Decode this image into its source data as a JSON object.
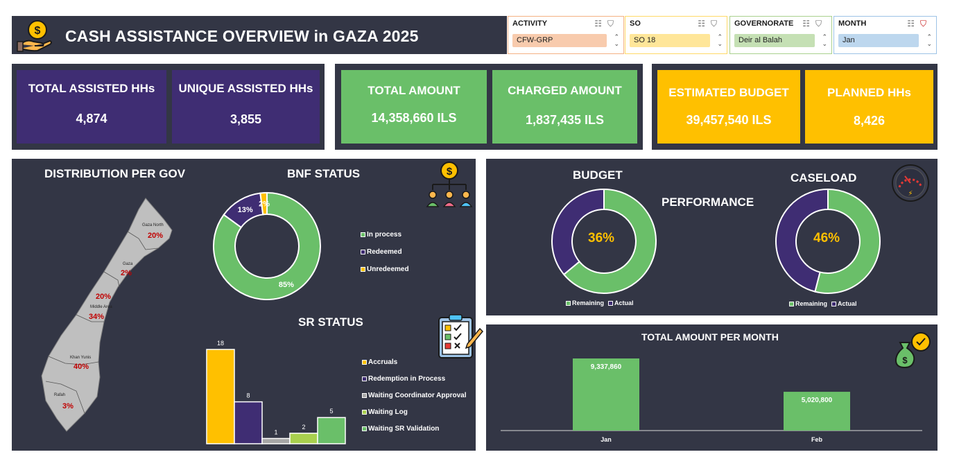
{
  "header": {
    "title": "CASH ASSISTANCE OVERVIEW in GAZA 2025"
  },
  "slicers": [
    {
      "label": "ACTIVITY",
      "value": "CFW-GRP",
      "color": "#f8cbad",
      "border": "#f4b183"
    },
    {
      "label": "SO",
      "value": "SO 18",
      "color": "#ffe699",
      "border": "#ffd966"
    },
    {
      "label": "GOVERNORATE",
      "value": "Deir al Balah",
      "color": "#c5e0b4",
      "border": "#a9d18e"
    },
    {
      "label": "MONTH",
      "value": "Jan",
      "color": "#bdd7ee",
      "border": "#9dc3e6"
    }
  ],
  "kpis": {
    "total_assisted_label": "TOTAL ASSISTED HHs",
    "total_assisted_value": "4,874",
    "unique_assisted_label": "UNIQUE ASSISTED HHs",
    "unique_assisted_value": "3,855",
    "total_amount_label": "TOTAL AMOUNT",
    "total_amount_value": "14,358,660 ILS",
    "charged_amount_label": "CHARGED AMOUNT",
    "charged_amount_value": "1,837,435 ILS",
    "estimated_budget_label": "ESTIMATED BUDGET",
    "estimated_budget_value": "39,457,540 ILS",
    "planned_hhs_label": "PLANNED HHs",
    "planned_hhs_value": "8,426"
  },
  "distribution": {
    "title": "DISTRIBUTION PER GOV",
    "regions": [
      {
        "name": "Gaza North",
        "pct": "20%"
      },
      {
        "name": "Gaza",
        "pct": "2%"
      },
      {
        "name": "Middle Area",
        "pct": "34%",
        "extra_pct": "20%"
      },
      {
        "name": "Khan Yunis",
        "pct": "40%"
      },
      {
        "name": "Rafah",
        "pct": "3%"
      }
    ]
  },
  "performance": {
    "title": "PERFORMANCE",
    "budget_title": "BUDGET",
    "caseload_title": "CASELOAD"
  },
  "colors": {
    "green": "#6abf69",
    "purple": "#3f2d73",
    "yellow": "#ffc000",
    "navy": "#333645",
    "lime": "#a9d04e",
    "gray": "#a6a6a6",
    "pct_text": "#ffc000",
    "map_red": "#c00000"
  },
  "chart_data": [
    {
      "type": "pie",
      "title": "BNF STATUS",
      "labels": [
        "In process",
        "Redeemed",
        "Unredeemed"
      ],
      "values": [
        85,
        13,
        2
      ],
      "value_labels": [
        "85%",
        "13%",
        "2%"
      ],
      "colors": [
        "#6abf69",
        "#3f2d73",
        "#ffc000"
      ],
      "legend": "right"
    },
    {
      "type": "bar",
      "title": "SR STATUS",
      "categories": [
        "Accruals",
        "Redemption in Process",
        "Waiting Coordinator Approval",
        "Waiting Log",
        "Waiting SR Validation"
      ],
      "values": [
        18,
        8,
        1,
        2,
        5
      ],
      "colors": [
        "#ffc000",
        "#3f2d73",
        "#a6a6a6",
        "#a9d04e",
        "#6abf69"
      ],
      "ylim": [
        0,
        18
      ],
      "legend": "right"
    },
    {
      "type": "pie",
      "title": "BUDGET",
      "labels": [
        "Remaining",
        "Actual"
      ],
      "values": [
        64,
        36
      ],
      "center_label": "36%",
      "colors": [
        "#6abf69",
        "#3f2d73"
      ],
      "legend": "bottom"
    },
    {
      "type": "pie",
      "title": "CASELOAD",
      "labels": [
        "Remaining",
        "Actual"
      ],
      "values": [
        54,
        46
      ],
      "center_label": "46%",
      "colors": [
        "#6abf69",
        "#3f2d73"
      ],
      "legend": "bottom"
    },
    {
      "type": "bar",
      "title": "TOTAL AMOUNT PER MONTH",
      "categories": [
        "Jan",
        "Feb"
      ],
      "values": [
        9337860,
        5020800
      ],
      "value_labels": [
        "9,337,860",
        "5,020,800"
      ],
      "colors": [
        "#6abf69",
        "#6abf69"
      ],
      "ylim": [
        0,
        9337860
      ]
    }
  ]
}
